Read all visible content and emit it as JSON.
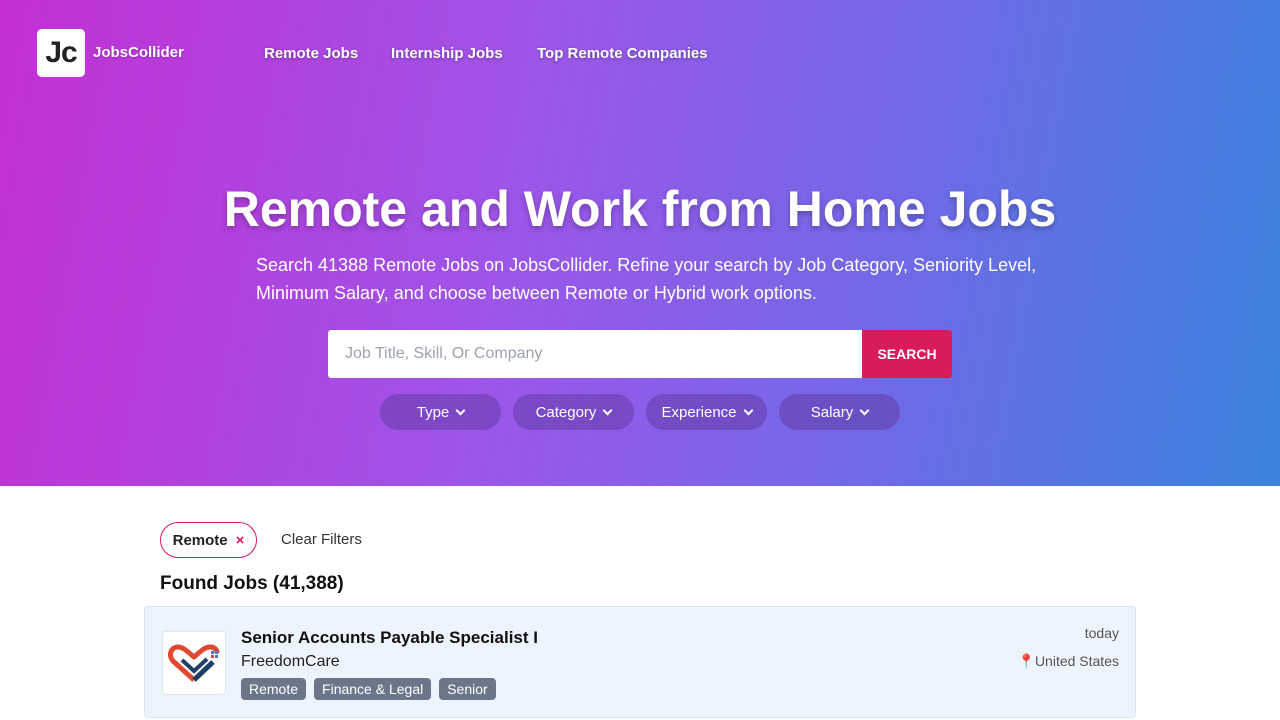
{
  "header": {
    "logo_text": "Jc",
    "brand_name": "JobsCollider",
    "nav": [
      {
        "label": "Remote Jobs"
      },
      {
        "label": "Internship Jobs"
      },
      {
        "label": "Top Remote Companies"
      }
    ]
  },
  "hero": {
    "title": "Remote and Work from Home Jobs",
    "subtitle": "Search 41388 Remote Jobs on JobsCollider. Refine your search by Job Category, Seniority Level, Minimum Salary, and choose between Remote or Hybrid work options.",
    "search": {
      "placeholder": "Job Title, Skill, Or Company",
      "value": "",
      "button_label": "SEARCH"
    },
    "filters": [
      {
        "label": "Type"
      },
      {
        "label": "Category"
      },
      {
        "label": "Experience"
      },
      {
        "label": "Salary"
      }
    ]
  },
  "results": {
    "active_filter": "Remote",
    "active_filter_remove": "×",
    "clear_label": "Clear Filters",
    "found_label": "Found Jobs (41,388)",
    "jobs": [
      {
        "title": "Senior Accounts Payable Specialist I",
        "company": "FreedomCare",
        "tags": [
          "Remote",
          "Finance & Legal",
          "Senior"
        ],
        "posted": "today",
        "location_pin": "📍",
        "location": "United States"
      }
    ]
  },
  "colors": {
    "accent": "#d81b5a",
    "tag_bg": "#6b7689",
    "card_bg": "#eef4fd"
  }
}
